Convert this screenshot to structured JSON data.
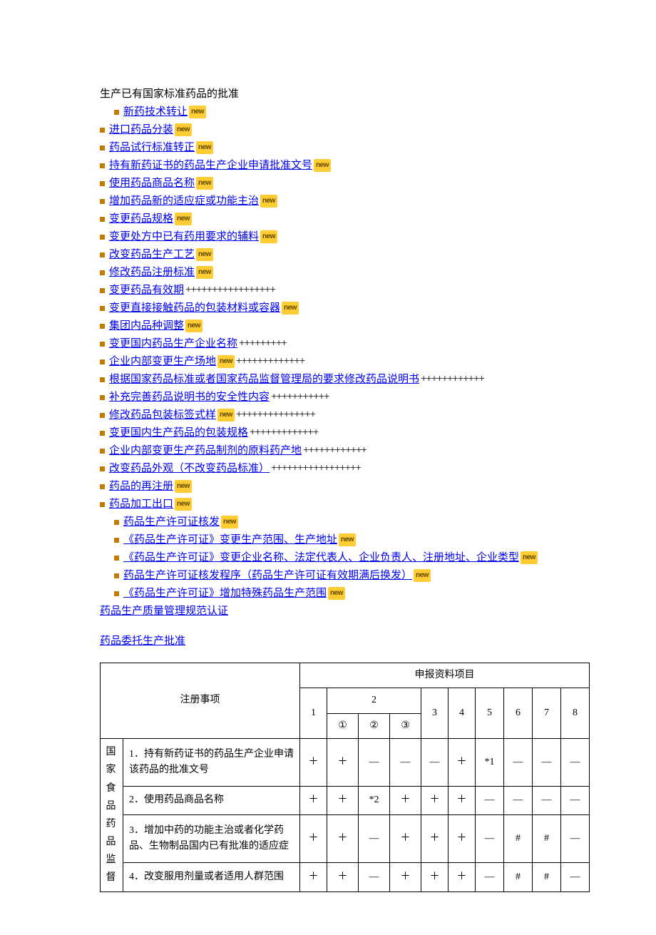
{
  "title": "生产已有国家标准药品的批准",
  "new_badge": "new",
  "links": [
    {
      "text": "新药技术转让",
      "bullet": true,
      "indent": true,
      "badge": true
    },
    {
      "text": "进口药品分装",
      "bullet": true,
      "badge": true
    },
    {
      "text": "药品试行标准转正",
      "bullet": true,
      "badge": true
    },
    {
      "text": "持有新药证书的药品生产企业申请批准文号",
      "bullet": true,
      "badge": true
    },
    {
      "text": "使用药品商品名称",
      "bullet": true,
      "badge": true
    },
    {
      "text": "增加药品新的适应症或功能主治",
      "bullet": true,
      "badge": true
    },
    {
      "text": "变更药品规格",
      "bullet": true,
      "badge": true
    },
    {
      "text": "变更处方中已有药用要求的辅料",
      "bullet": true,
      "badge": true
    },
    {
      "text": "改变药品生产工艺",
      "bullet": true,
      "badge": true
    },
    {
      "text": "修改药品注册标准",
      "bullet": true,
      "badge": true
    },
    {
      "text": "变更药品有效期",
      "bullet": true,
      "suffix": "+++++++++++++++++"
    },
    {
      "text": "变更直接接触药品的包装材料或容器",
      "bullet": true,
      "badge": true
    },
    {
      "text": "集团内品种调整",
      "bullet": true,
      "badge": true
    },
    {
      "text": "变更国内药品生产企业名称",
      "bullet": true,
      "suffix": "+++++++++"
    },
    {
      "text": "企业内部变更生产场地",
      "bullet": true,
      "badge": true,
      "suffix": "+++++++++++++"
    },
    {
      "text": "根据国家药品标准或者国家药品监督管理局的要求修改药品说明书",
      "bullet": true,
      "suffix": "++++++++++++"
    },
    {
      "text": "补充完善药品说明书的安全性内容",
      "bullet": true,
      "suffix": "+++++++++++"
    },
    {
      "text": "修改药品包装标签式样",
      "bullet": true,
      "badge": true,
      "suffix": "+++++++++++++++"
    },
    {
      "text": "变更国内生产药品的包装规格",
      "bullet": true,
      "suffix": "+++++++++++++"
    },
    {
      "text": "企业内部变更生产药品制剂的原料药产地",
      "bullet": true,
      "suffix": "++++++++++++"
    },
    {
      "text": "改变药品外观（不改变药品标准）",
      "bullet": true,
      "suffix": "+++++++++++++++++"
    },
    {
      "text": "药品的再注册",
      "bullet": true,
      "badge": true
    },
    {
      "text": "药品加工出口",
      "bullet": true,
      "badge": true
    },
    {
      "text": "药品生产许可证核发",
      "bullet": true,
      "indent": true,
      "badge": true
    },
    {
      "text": "《药品生产许可证》变更生产范围、生产地址",
      "bullet": true,
      "indent": true,
      "badge": true
    },
    {
      "text": "《药品生产许可证》变更企业名称、法定代表人、企业负责人、注册地址、企业类型",
      "bullet": true,
      "indent": true,
      "badge": true
    },
    {
      "text": "药品生产许可证核发程序（药品生产许可证有效期满后换发）",
      "bullet": true,
      "indent": true,
      "badge": true
    },
    {
      "text": "《药品生产许可证》增加特殊药品生产范围",
      "bullet": true,
      "indent": true,
      "badge": true
    }
  ],
  "section_links": [
    "药品生产质量管理规范认证",
    "药品委托生产批准"
  ],
  "table": {
    "header_main": "注册事项",
    "header_right": "申报资料项目",
    "cols_top": [
      "1",
      "2",
      "3",
      "4",
      "5",
      "6",
      "7",
      "8"
    ],
    "cols_sub2": [
      "①",
      "②",
      "③"
    ],
    "vlabel": "国家食品药品监督",
    "rows": [
      {
        "label": "1．持有新药证书的药品生产企业申请该药品的批准文号",
        "cells": [
          "＋",
          "＋",
          "—",
          "—",
          "—",
          "＋",
          "*1",
          "—",
          "—",
          "—"
        ]
      },
      {
        "label": "2．使用药品商品名称",
        "cells": [
          "＋",
          "＋",
          "*2",
          "＋",
          "＋",
          "＋",
          "—",
          "—",
          "—",
          "—"
        ]
      },
      {
        "label": "3．增加中药的功能主治或者化学药品、生物制品国内已有批准的适应症",
        "cells": [
          "＋",
          "＋",
          "—",
          "＋",
          "＋",
          "＋",
          "—",
          "#",
          "#",
          "—"
        ]
      },
      {
        "label": "4．改变服用剂量或者适用人群范围",
        "cells": [
          "＋",
          "＋",
          "—",
          "＋",
          "＋",
          "＋",
          "—",
          "#",
          "#",
          "—"
        ]
      }
    ]
  }
}
